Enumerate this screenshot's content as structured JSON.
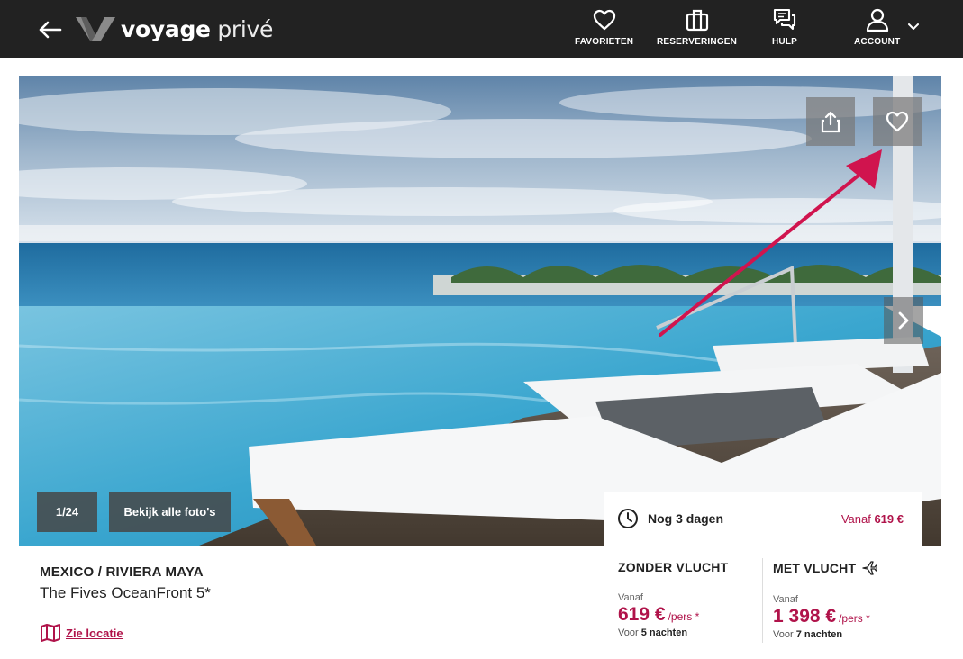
{
  "header": {
    "brand_bold": "voyage",
    "brand_light": "privé",
    "nav": [
      {
        "label": "FAVORIETEN",
        "icon": "heart-icon"
      },
      {
        "label": "RESERVERINGEN",
        "icon": "suitcase-icon"
      },
      {
        "label": "HULP",
        "icon": "chat-icon"
      },
      {
        "label": "ACCOUNT",
        "icon": "user-icon"
      }
    ]
  },
  "gallery": {
    "counter": "1/24",
    "all_photos_label": "Bekijk alle foto's"
  },
  "offer_card": {
    "deadline": "Nog 3 dagen",
    "from_prefix": "Vanaf",
    "from_price": "619 €"
  },
  "hotel": {
    "destination": "MEXICO / RIVIERA MAYA",
    "name": "The Fives OceanFront 5*",
    "location_link": "Zie locatie"
  },
  "options": [
    {
      "title": "ZONDER VLUCHT",
      "from": "Vanaf",
      "price": "619 €",
      "per": "/pers *",
      "voor": "Voor",
      "nights": "5 nachten"
    },
    {
      "title": "MET VLUCHT",
      "from": "Vanaf",
      "price": "1 398 €",
      "per": "/pers *",
      "voor": "Voor",
      "nights": "7 nachten"
    }
  ],
  "colors": {
    "header_bg": "#222222",
    "accent": "#b0134a"
  }
}
